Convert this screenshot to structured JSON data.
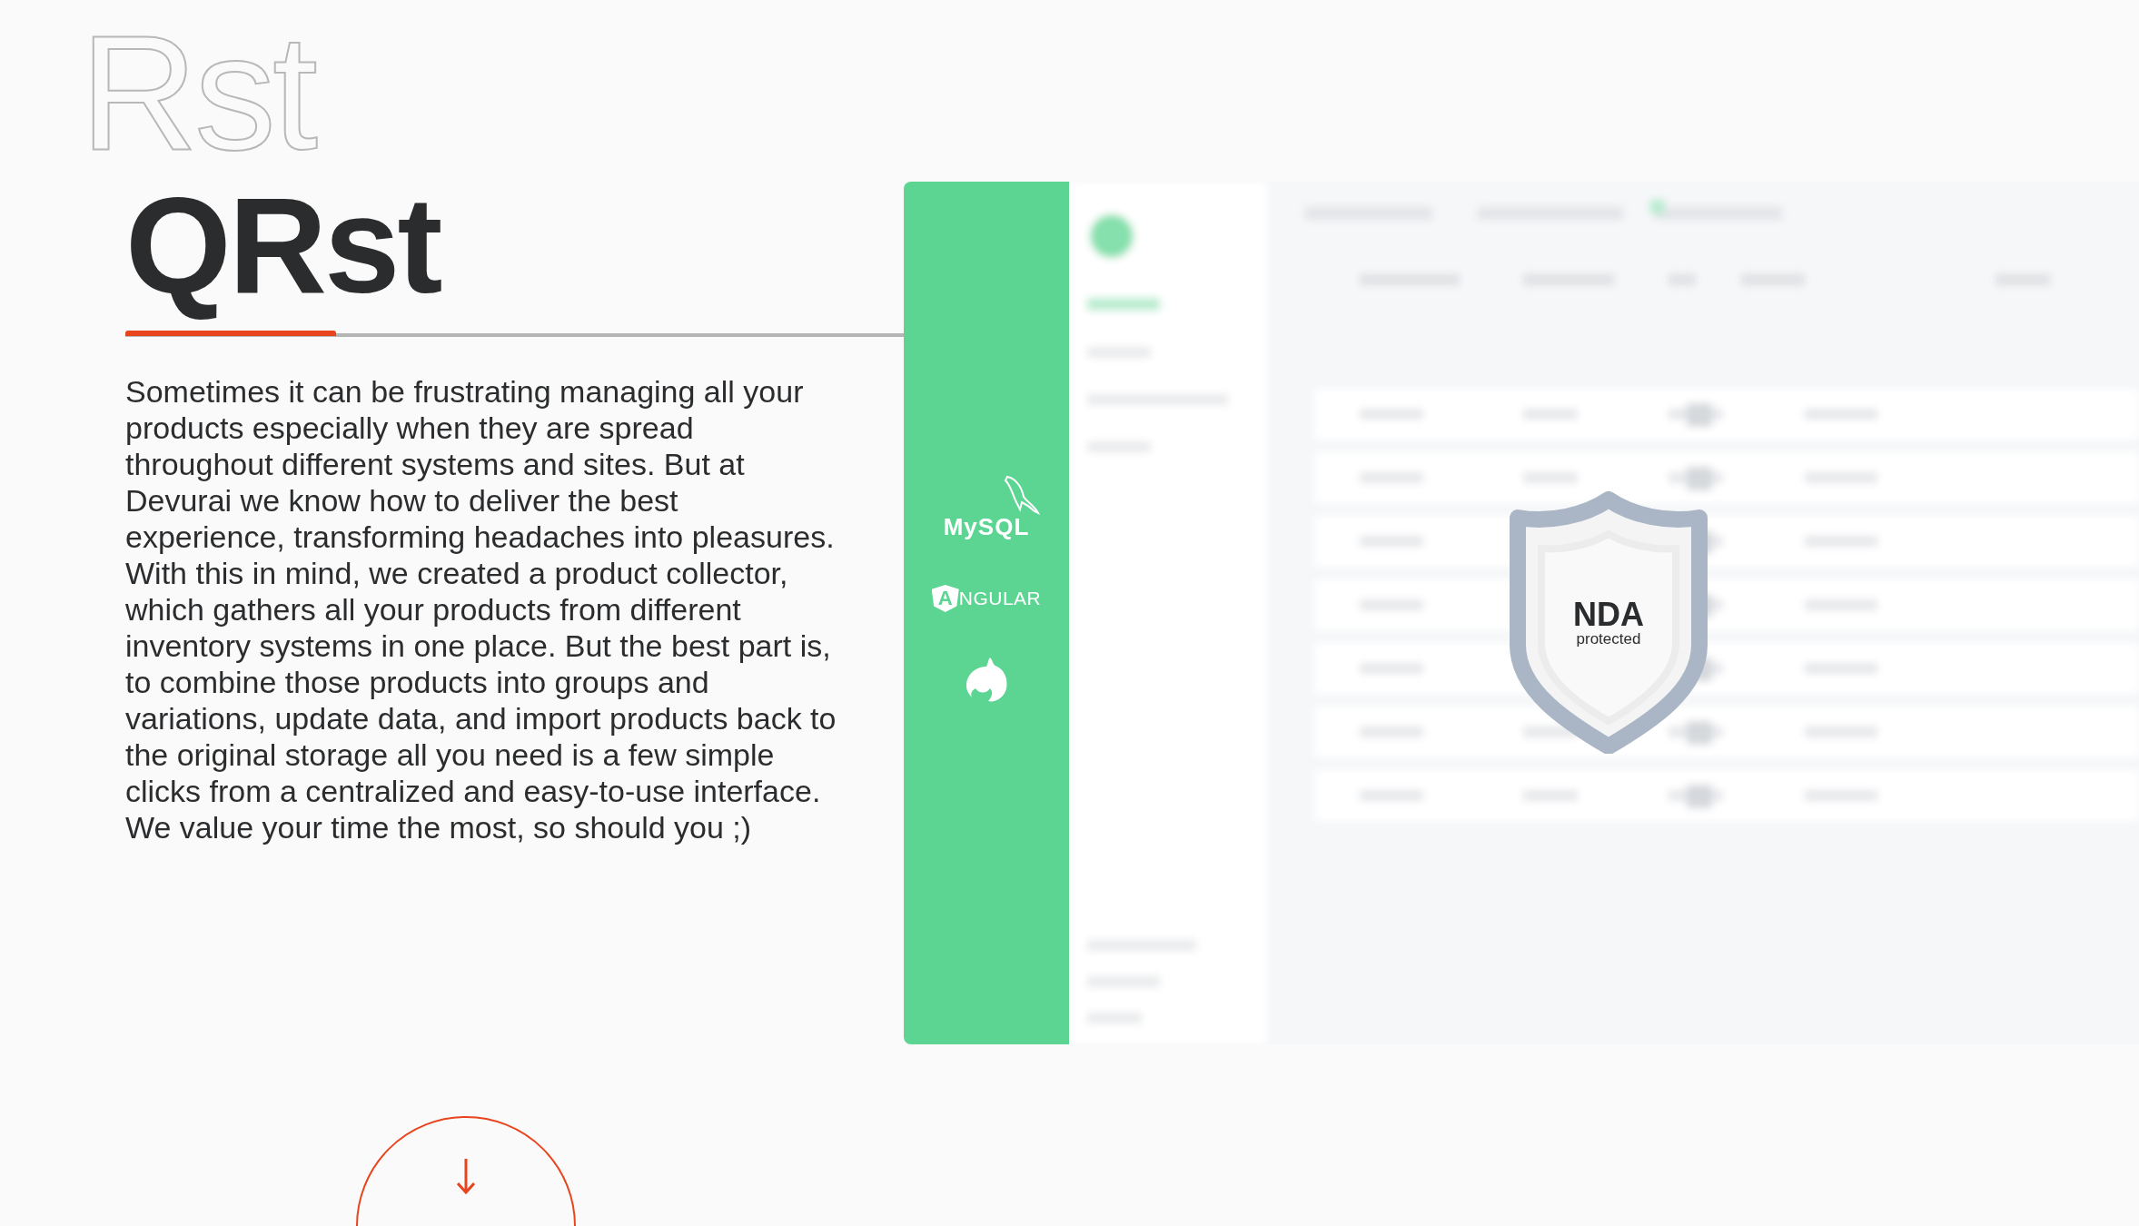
{
  "background_title": "Rst",
  "title": "QRst",
  "description": [
    "Sometimes it can be frustrating managing all your products especially when they are spread throughout different systems and sites. But at Devurai we know how to deliver the best experience, transforming headaches into pleasures.",
    "With this in mind, we created a product collector, which gathers all your products from different inventory systems in one place. But the best part is, to combine those products into groups and variations, update data, and import products back to the original storage all you need is a few simple clicks from a centralized and easy-to-use interface. We value your time the most, so should you ;)"
  ],
  "tech_logos": [
    {
      "kind": "mysql",
      "text": "MySQL"
    },
    {
      "kind": "angular",
      "mark": "A",
      "text": "NGULAR"
    },
    {
      "kind": "nest"
    }
  ],
  "app_preview": {
    "kind": "picture"
  },
  "nda_badge": {
    "title": "NDA",
    "subtitle": "protected"
  }
}
